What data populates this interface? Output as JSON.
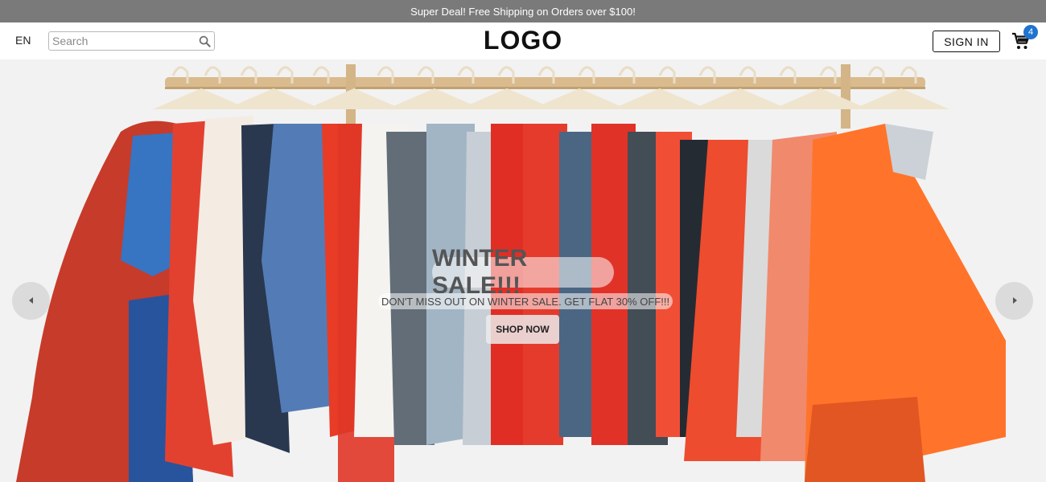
{
  "announcement": {
    "text": "Super Deal! Free Shipping on Orders over $100!"
  },
  "header": {
    "language": "EN",
    "search": {
      "placeholder": "Search",
      "value": ""
    },
    "logo": "LOGO",
    "signin_label": "SIGN IN",
    "cart_count": "4",
    "icons": {
      "search": "search-icon",
      "cart": "cart-icon"
    }
  },
  "hero": {
    "title": "WINTER SALE!!!",
    "subtitle": "DON'T MISS OUT ON WINTER SALE. GET FLAT 30% OFF!!!",
    "cta_label": "SHOP NOW",
    "image": "clothing-rack-photo",
    "icons": {
      "prev": "chevron-left-icon",
      "next": "chevron-right-icon"
    }
  },
  "colors": {
    "announcement_bg": "#7a7a7a",
    "badge": "#1f73d1",
    "hero_bg": "#f2f2f2"
  }
}
